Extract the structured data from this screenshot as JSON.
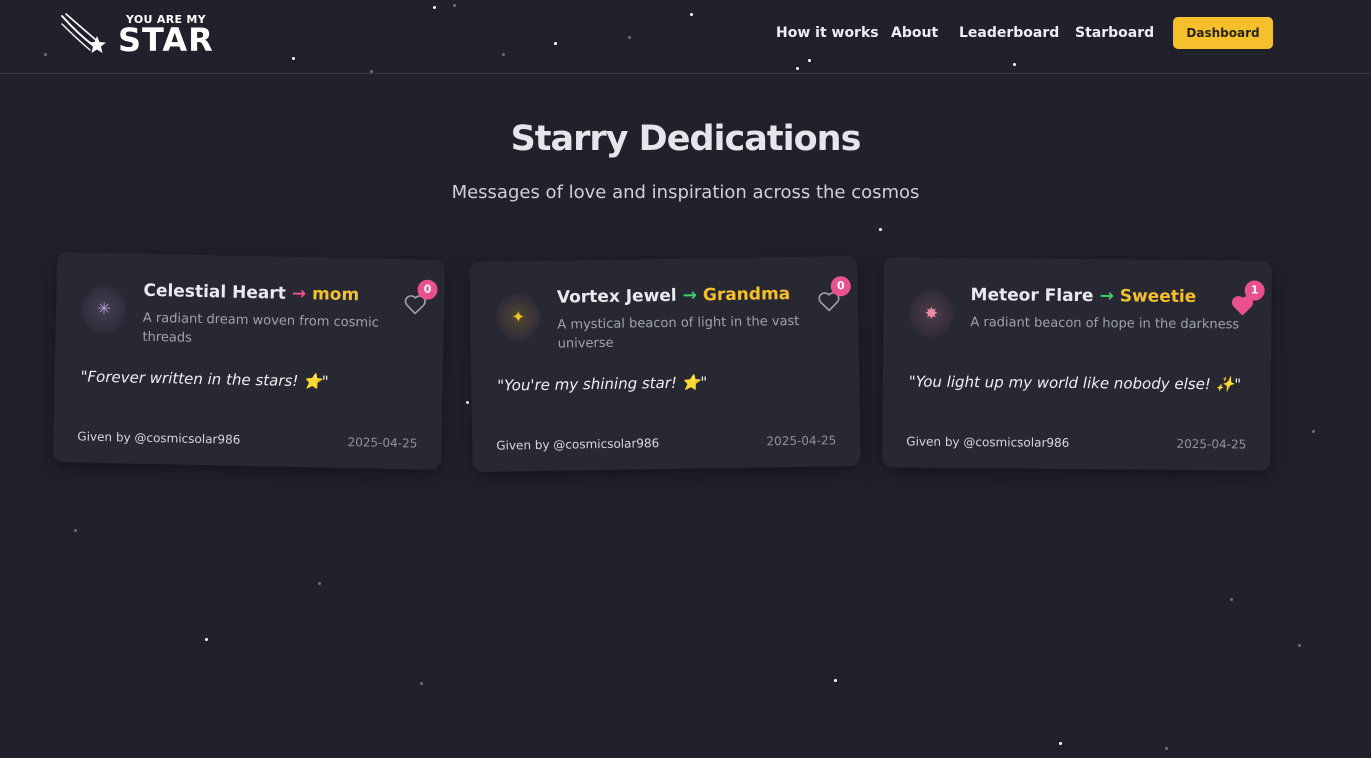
{
  "brand": {
    "tagline": "YOU ARE MY",
    "name": "STAR"
  },
  "nav": {
    "links": [
      "How it works",
      "About",
      "Leaderboard",
      "Starboard"
    ],
    "cta_label": "Dashboard"
  },
  "hero": {
    "title": "Starry Dedications",
    "subtitle": "Messages of love and inspiration across the cosmos"
  },
  "colors": {
    "background": "#20212a",
    "accent_yellow": "#f5c02c",
    "accent_pink": "#e8508f",
    "accent_green": "#3ccf6e",
    "card": "#272831"
  },
  "cards": [
    {
      "star_name": "Celestial Heart",
      "arrow": "→",
      "arrow_color": "#e8508f",
      "recipient": "mom",
      "description": "A radiant dream woven from cosmic threads",
      "message": "\"Forever written in the stars! ⭐\"",
      "given_by": "Given by @cosmicsolar986",
      "date": "2025-04-25",
      "likes": "0",
      "liked": false,
      "avatar_icon": "firework-icon",
      "avatar_glyph": "✳",
      "avatar_color": "#b7a0d8"
    },
    {
      "star_name": "Vortex Jewel",
      "arrow": "→",
      "arrow_color": "#3ccf6e",
      "recipient": "Grandma",
      "description": "A mystical beacon of light in the vast universe",
      "message": "\"You're my shining star! ⭐\"",
      "given_by": "Given by @cosmicsolar986",
      "date": "2025-04-25",
      "likes": "0",
      "liked": false,
      "avatar_icon": "sparkle-icon",
      "avatar_glyph": "✦",
      "avatar_color": "#f5c02c"
    },
    {
      "star_name": "Meteor Flare",
      "arrow": "→",
      "arrow_color": "#3ccf6e",
      "recipient": "Sweetie",
      "description": "A radiant beacon of hope in the darkness",
      "message": "\"You light up my world like nobody else! ✨\"",
      "given_by": "Given by @cosmicsolar986",
      "date": "2025-04-25",
      "likes": "1",
      "liked": true,
      "avatar_icon": "burst-icon",
      "avatar_glyph": "✸",
      "avatar_color": "#f08aa8"
    }
  ]
}
